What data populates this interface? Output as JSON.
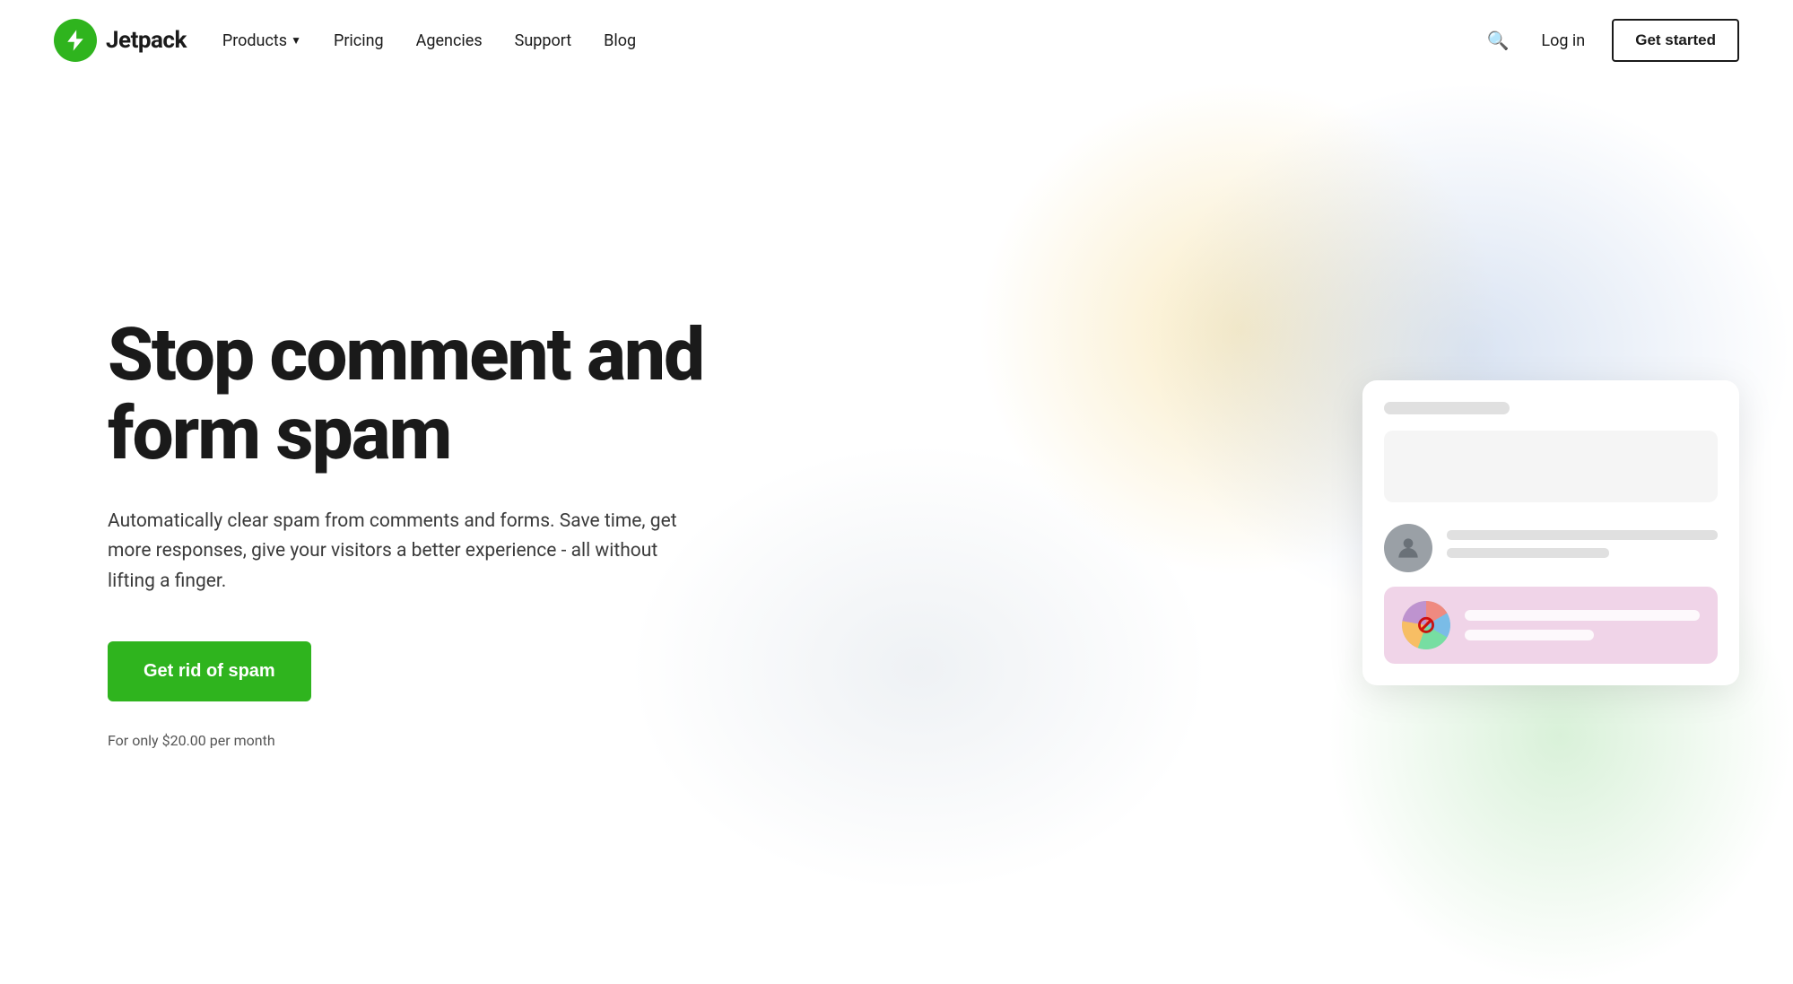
{
  "brand": {
    "name": "Jetpack",
    "logo_alt": "Jetpack logo"
  },
  "nav": {
    "products_label": "Products",
    "pricing_label": "Pricing",
    "agencies_label": "Agencies",
    "support_label": "Support",
    "blog_label": "Blog",
    "login_label": "Log in",
    "get_started_label": "Get started",
    "search_aria": "Search"
  },
  "hero": {
    "title": "Stop comment and form spam",
    "description": "Automatically clear spam from comments and forms. Save time, get more responses, give your visitors a better experience - all without lifting a finger.",
    "cta_label": "Get rid of spam",
    "price_note": "For only $20.00 per month"
  }
}
